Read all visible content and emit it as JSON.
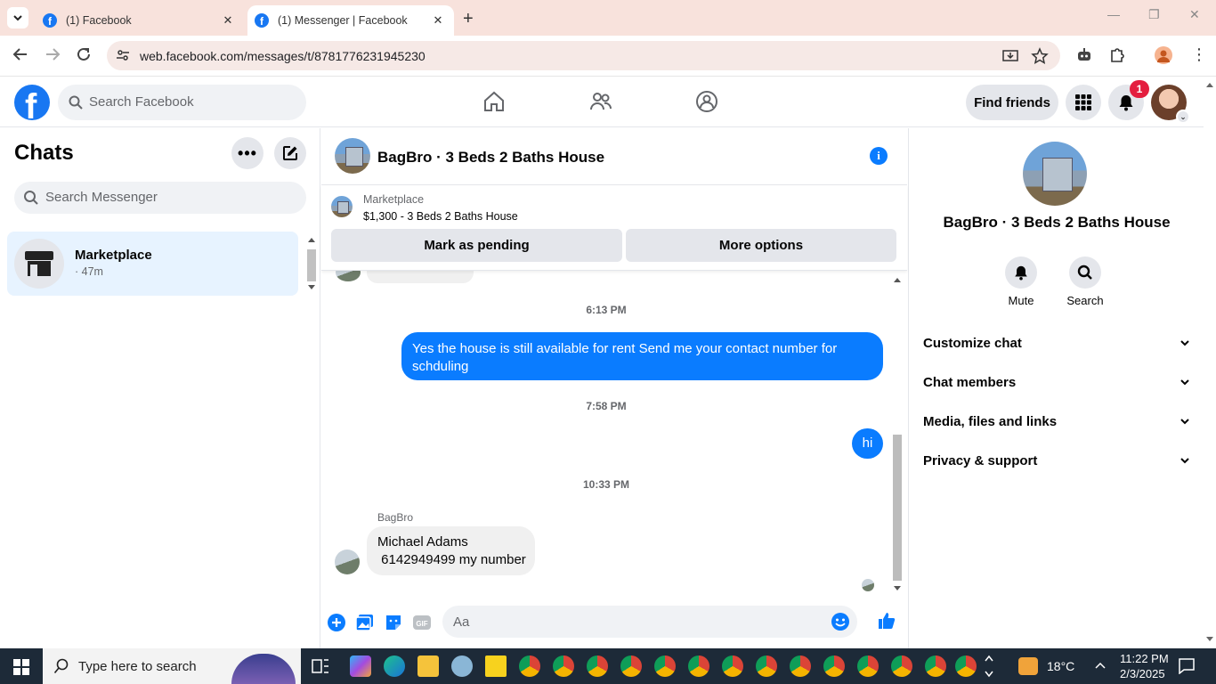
{
  "browser": {
    "tabs": [
      {
        "title": "(1) Facebook",
        "active": false
      },
      {
        "title": "(1) Messenger | Facebook",
        "active": true
      }
    ],
    "url": "web.facebook.com/messages/t/8781776231945230"
  },
  "facebook": {
    "search_placeholder": "Search Facebook",
    "find_friends_label": "Find friends",
    "notification_count": "1"
  },
  "chats_panel": {
    "title": "Chats",
    "search_placeholder": "Search Messenger",
    "items": [
      {
        "name": "Marketplace",
        "meta": "· 47m"
      }
    ]
  },
  "conversation": {
    "title": "BagBro · 3 Beds 2 Baths House",
    "marketplace": {
      "label": "Marketplace",
      "listing": "$1,300 - 3 Beds 2 Baths House",
      "mark_pending_label": "Mark as pending",
      "more_options_label": "More options"
    },
    "messages": [
      {
        "type": "timestamp",
        "text": "6:13 PM"
      },
      {
        "type": "outgoing",
        "text": "Yes the house is still available for rent Send me your contact number for schduling"
      },
      {
        "type": "timestamp",
        "text": "7:58 PM"
      },
      {
        "type": "outgoing",
        "text": "hi"
      },
      {
        "type": "timestamp",
        "text": "10:33 PM"
      },
      {
        "type": "incoming",
        "sender": "BagBro",
        "line1": "Michael Adams",
        "line2": " 6142949499 my number"
      }
    ],
    "composer_placeholder": "Aa"
  },
  "info_panel": {
    "name": "BagBro · 3 Beds 2 Baths House",
    "actions": [
      {
        "label": "Mute",
        "icon": "bell-icon"
      },
      {
        "label": "Search",
        "icon": "search-icon"
      }
    ],
    "sections": [
      "Customize chat",
      "Chat members",
      "Media, files and links",
      "Privacy & support"
    ]
  },
  "taskbar": {
    "search_placeholder": "Type here to search",
    "weather": "18°C",
    "time": "11:22 PM",
    "date": "2/3/2025"
  },
  "colors": {
    "facebook_blue": "#1877f2",
    "messenger_blue": "#0a7cff",
    "selected_chat": "#e7f3ff",
    "notification_red": "#e41e3f"
  }
}
